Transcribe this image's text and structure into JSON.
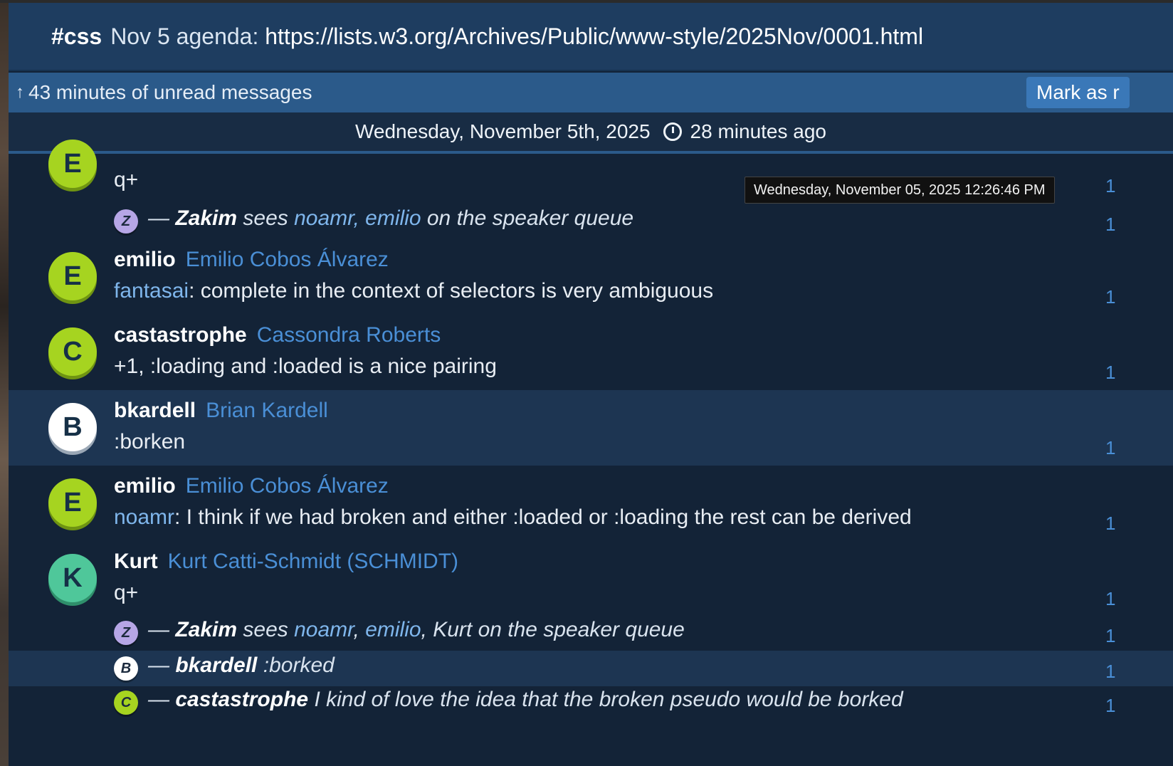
{
  "topic": {
    "channel": "#css",
    "text_prefix": "Nov 5 agenda: ",
    "url": "https://lists.w3.org/Archives/Public/www-style/2025Nov/0001.html"
  },
  "unread": {
    "arrow": "↑",
    "label": "43 minutes of unread messages",
    "mark_read_label": "Mark as r"
  },
  "date_bar": {
    "date": "Wednesday, November 5th, 2025",
    "relative": "28 minutes ago"
  },
  "tooltip": "Wednesday, November 05, 2025 12:26:46 PM",
  "messages": [
    {
      "avatar_letter": "E",
      "text": "q+",
      "time": "1"
    },
    {
      "mini_letter": "Z",
      "dash": "—",
      "actor": "Zakim",
      "sees": "sees",
      "mentions": "noamr, emilio",
      "rest": "on the speaker queue",
      "time": "1"
    },
    {
      "avatar_letter": "E",
      "nick": "emilio",
      "realname": "Emilio Cobos Álvarez",
      "mention": "fantasai",
      "text": ": complete in the context of selectors is very ambiguous",
      "time": "1"
    },
    {
      "avatar_letter": "C",
      "nick": "castastrophe",
      "realname": "Cassondra Roberts",
      "text": "+1, :loading and :loaded is a nice pairing",
      "time": "1"
    },
    {
      "avatar_letter": "B",
      "nick": "bkardell",
      "realname": "Brian Kardell",
      "text": ":borken",
      "time": "1"
    },
    {
      "avatar_letter": "E",
      "nick": "emilio",
      "realname": "Emilio Cobos Álvarez",
      "mention": "noamr",
      "text": ": I think if we had broken and either :loaded or :loading the rest can be derived",
      "time": "1"
    },
    {
      "avatar_letter": "K",
      "nick": "Kurt",
      "realname": "Kurt Catti-Schmidt (SCHMIDT)",
      "text": "q+",
      "time": "1"
    },
    {
      "mini_letter": "Z",
      "dash": "—",
      "actor": "Zakim",
      "sees": "sees",
      "mention_a": "noamr",
      "comma1": ", ",
      "mention_b": "emilio",
      "rest": ", Kurt on the speaker queue",
      "time": "1"
    },
    {
      "mini_letter": "B",
      "dash": "—",
      "actor": "bkardell",
      "rest": ":borked",
      "time": "1"
    },
    {
      "mini_letter": "C",
      "dash": "—",
      "actor": "castastrophe",
      "rest": "I kind of love the idea that the broken pseudo would be borked",
      "time": "1"
    }
  ],
  "colors": {
    "background": "#132337",
    "topic_bar": "#1e3d60",
    "unread_bar": "#2b5a8a",
    "highlight_row": "#1d3552",
    "realname": "#4a8fd6",
    "mention": "#7fb6ec"
  }
}
